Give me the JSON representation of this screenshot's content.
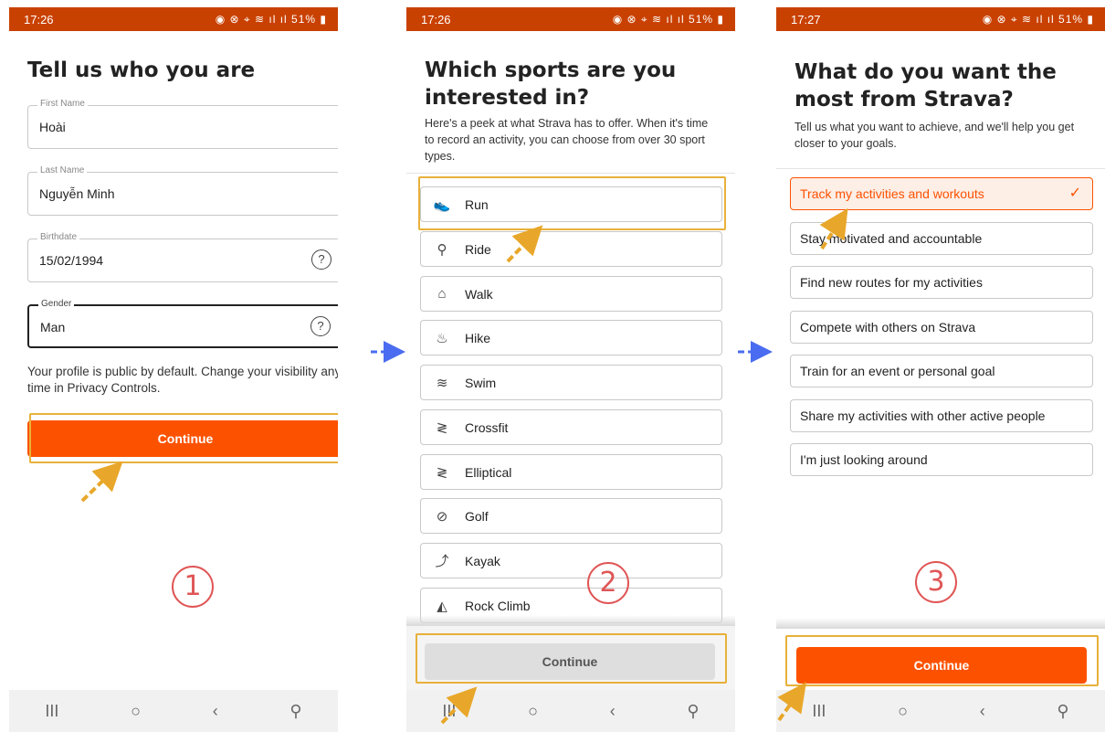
{
  "colors": {
    "accent": "#fc5200",
    "statusbar": "#c94100",
    "highlight": "#e8b13a",
    "step_circle": "#e05555",
    "flow_arrow": "#4a6cf0"
  },
  "screen1": {
    "status": {
      "time": "17:26",
      "indicators": "51%"
    },
    "title": "Tell us who you are",
    "fields": [
      {
        "label": "First Name",
        "value": "Hoài"
      },
      {
        "label": "Last Name",
        "value": "Nguyễn Minh"
      },
      {
        "label": "Birthdate",
        "value": "15/02/1994",
        "help_icon": "question-circle-icon"
      },
      {
        "label": "Gender",
        "value": "Man",
        "help_icon": "question-circle-icon"
      }
    ],
    "note": "Your profile is public by default. Change your visibility any time in Privacy Controls.",
    "continue_label": "Continue",
    "step_number": "1"
  },
  "screen2": {
    "status": {
      "time": "17:26",
      "indicators": "51%"
    },
    "title": "Which sports are you interested in?",
    "subtitle": "Here's a peek at what Strava has to offer. When it's time to record an activity, you can choose from over 30 sport types.",
    "sports": [
      {
        "label": "Run",
        "icon": "run-shoe-icon"
      },
      {
        "label": "Ride",
        "icon": "bike-icon"
      },
      {
        "label": "Walk",
        "icon": "walk-shoe-icon"
      },
      {
        "label": "Hike",
        "icon": "hike-boot-icon"
      },
      {
        "label": "Swim",
        "icon": "swim-icon"
      },
      {
        "label": "Crossfit",
        "icon": "crossfit-icon"
      },
      {
        "label": "Elliptical",
        "icon": "elliptical-icon"
      },
      {
        "label": "Golf",
        "icon": "golf-icon"
      },
      {
        "label": "Kayak",
        "icon": "kayak-icon"
      },
      {
        "label": "Rock Climb",
        "icon": "climbing-shoe-icon"
      }
    ],
    "continue_label": "Continue",
    "step_number": "2"
  },
  "screen3": {
    "status": {
      "time": "17:27",
      "indicators": "51%"
    },
    "title": "What do you want the most from Strava?",
    "subtitle": "Tell us what you want to achieve, and we'll help you get closer to your goals.",
    "goals": [
      {
        "label": "Track my activities and workouts",
        "selected": true
      },
      {
        "label": "Stay motivated and accountable",
        "selected": false
      },
      {
        "label": "Find new routes for my activities",
        "selected": false
      },
      {
        "label": "Compete with others on Strava",
        "selected": false
      },
      {
        "label": "Train for an event or personal goal",
        "selected": false
      },
      {
        "label": "Share my activities with other active people",
        "selected": false
      },
      {
        "label": "I'm just looking around",
        "selected": false
      }
    ],
    "continue_label": "Continue",
    "step_number": "3"
  },
  "navbar": {
    "recents": "III",
    "home": "○",
    "back": "‹",
    "accessibility": "⚲"
  }
}
